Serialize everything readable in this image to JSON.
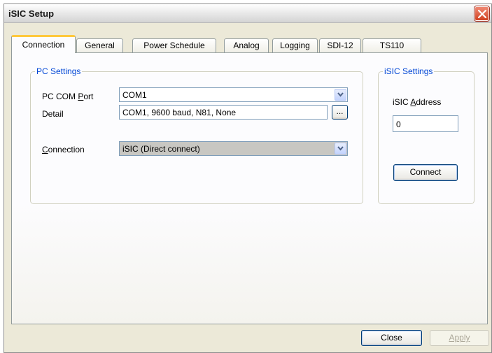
{
  "window": {
    "title": "iSIC Setup"
  },
  "tabs": [
    {
      "label": "Connection",
      "active": true
    },
    {
      "label": "General"
    },
    {
      "label": "Power Schedule"
    },
    {
      "label": "Analog"
    },
    {
      "label": "Logging"
    },
    {
      "label": "SDI-12"
    },
    {
      "label": "TS110"
    }
  ],
  "pc_settings": {
    "legend": "PC Settings",
    "com_port_label": "PC COM Port",
    "com_port_value": "COM1",
    "detail_label": "Detail",
    "detail_value": "COM1, 9600 baud, N81, None",
    "detail_button_label": "...",
    "connection_label": "Connection",
    "connection_value": "iSIC (Direct connect)"
  },
  "isic_settings": {
    "legend": "iSIC Settings",
    "address_label": "iSIC Address",
    "address_value": "0",
    "connect_button_label": "Connect"
  },
  "footer": {
    "close_label": "Close",
    "apply_label": "Apply"
  },
  "icons": {
    "close": "close-icon",
    "dropdown": "chevron-down-icon"
  },
  "colors": {
    "active_tab_accent": "#ffc83c",
    "group_legend": "#0046d5",
    "close_button": "#d04020"
  }
}
